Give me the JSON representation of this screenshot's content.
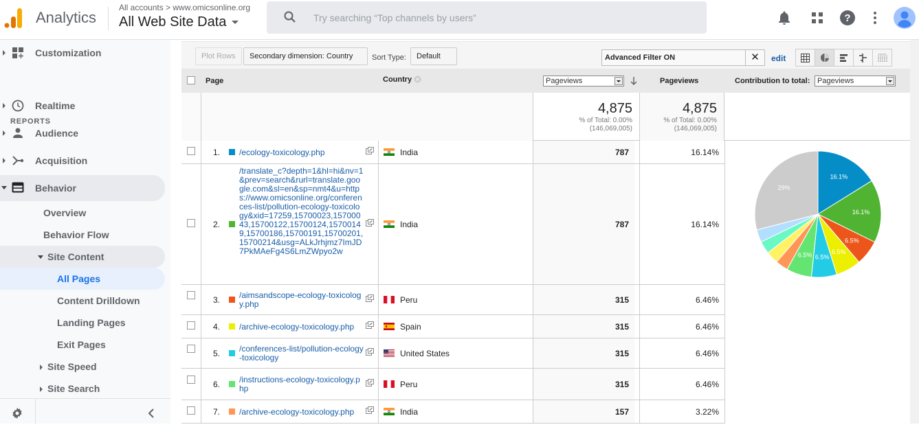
{
  "header": {
    "app_name": "Analytics",
    "breadcrumb": "All accounts > www.omicsonline.org",
    "view_name": "All Web Site Data",
    "search_placeholder": "Try searching “Top channels by users”",
    "icons": [
      "notifications-bell-icon",
      "apps-grid-icon",
      "help-icon",
      "more-vert-icon",
      "account-avatar-icon"
    ]
  },
  "sidebar": {
    "customization": "Customization",
    "reports_label": "REPORTS",
    "items": [
      {
        "label": "Realtime",
        "icon": "clock-icon"
      },
      {
        "label": "Audience",
        "icon": "person-icon"
      },
      {
        "label": "Acquisition",
        "icon": "acquisition-icon"
      },
      {
        "label": "Behavior",
        "icon": "behavior-icon"
      }
    ],
    "behavior_sub": {
      "overview": "Overview",
      "behavior_flow": "Behavior Flow",
      "site_content": "Site Content",
      "site_content_items": [
        "All Pages",
        "Content Drilldown",
        "Landing Pages",
        "Exit Pages"
      ],
      "site_speed": "Site Speed",
      "site_search": "Site Search"
    }
  },
  "toolbar": {
    "plot_rows": "Plot Rows",
    "secondary_dimension": "Secondary dimension: Country",
    "sort_type_label": "Sort Type:",
    "sort_type_value": "Default",
    "filter_text": "Advanced Filter ON",
    "filter_clear": "✕",
    "edit": "edit",
    "view_modes": [
      "data-table",
      "percentage-pie",
      "performance-bar",
      "comparison",
      "term-cloud"
    ],
    "active_view": "percentage-pie"
  },
  "table": {
    "headers": {
      "page": "Page",
      "country": "Country",
      "metric_select": "Pageviews",
      "pageviews": "Pageviews",
      "contribution_label": "Contribution to total:",
      "contribution_select": "Pageviews"
    },
    "totals": {
      "value1": "4,875",
      "pct1": "% of Total: 0.00%",
      "total1": "(146,069,005)",
      "value2": "4,875",
      "pct2": "% of Total: 0.00%",
      "total2": "(146,069,005)"
    },
    "rows": [
      {
        "num": "1.",
        "color": "#058dc7",
        "page": "/ecology-toxicology.php",
        "country": "India",
        "flag": "india",
        "pageviews": "787",
        "pct": "16.14%"
      },
      {
        "num": "2.",
        "color": "#50b432",
        "page": "/translate_c?depth=1&hl=hi&nv=1&prev=search&rurl=translate.google.com&sl=en&sp=nmt4&u=https://www.omicsonline.org/conferences-list/pollution-ecology-toxicology&xid=17259,15700023,15700043,15700122,15700124,15700149,15700186,15700191,15700201,15700214&usg=ALkJrhjmz7ImJD7PkMAeFg4S6LmZWpyo2w",
        "country": "India",
        "flag": "india",
        "pageviews": "787",
        "pct": "16.14%"
      },
      {
        "num": "3.",
        "color": "#ed561b",
        "page": "/aimsandscope-ecology-toxicology.php",
        "country": "Peru",
        "flag": "peru",
        "pageviews": "315",
        "pct": "6.46%"
      },
      {
        "num": "4.",
        "color": "#edef00",
        "page": "/archive-ecology-toxicology.php",
        "country": "Spain",
        "flag": "spain",
        "pageviews": "315",
        "pct": "6.46%"
      },
      {
        "num": "5.",
        "color": "#24cbe5",
        "page": "/conferences-list/pollution-ecology-toxicology",
        "country": "United States",
        "flag": "usa",
        "pageviews": "315",
        "pct": "6.46%"
      },
      {
        "num": "6.",
        "color": "#64e572",
        "page": "/instructions-ecology-toxicology.php",
        "country": "Peru",
        "flag": "peru",
        "pageviews": "315",
        "pct": "6.46%"
      },
      {
        "num": "7.",
        "color": "#ff9655",
        "page": "/archive-ecology-toxicology.php",
        "country": "India",
        "flag": "india",
        "pageviews": "157",
        "pct": "3.22%"
      }
    ]
  },
  "chart_data": {
    "type": "pie",
    "title": "Contribution to total: Pageviews",
    "slices": [
      {
        "label": "1",
        "value": 16.14,
        "color": "#058dc7",
        "text": "16.1%"
      },
      {
        "label": "2",
        "value": 16.14,
        "color": "#50b432",
        "text": "16.1%"
      },
      {
        "label": "3",
        "value": 6.46,
        "color": "#ed561b",
        "text": "6.5%"
      },
      {
        "label": "4",
        "value": 6.46,
        "color": "#edef00",
        "text": "6.5%"
      },
      {
        "label": "5",
        "value": 6.46,
        "color": "#24cbe5",
        "text": "6.5%"
      },
      {
        "label": "6",
        "value": 6.46,
        "color": "#64e572",
        "text": "6.5%"
      },
      {
        "label": "7",
        "value": 3.22,
        "color": "#ff9655",
        "text": ""
      },
      {
        "label": "8",
        "value": 3.22,
        "color": "#fff263",
        "text": ""
      },
      {
        "label": "9",
        "value": 3.22,
        "color": "#6af9c4",
        "text": ""
      },
      {
        "label": "10",
        "value": 3.22,
        "color": "#b2deff",
        "text": ""
      },
      {
        "label": "Other",
        "value": 29.0,
        "color": "#cccccc",
        "text": "29%"
      }
    ]
  }
}
